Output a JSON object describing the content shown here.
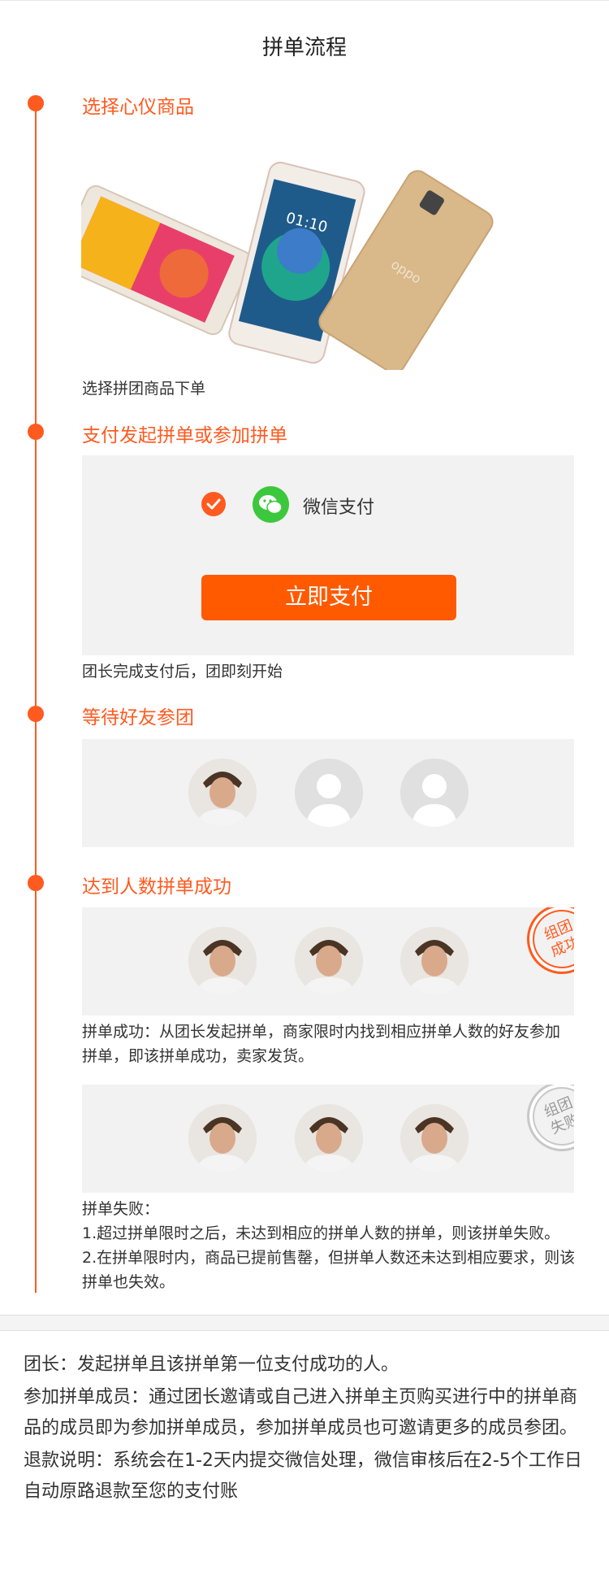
{
  "page": {
    "title": "拼单流程"
  },
  "steps": {
    "select": {
      "title": "选择心仪商品",
      "caption": "选择拼团商品下单"
    },
    "pay": {
      "title": "支付发起拼单或参加拼单",
      "method_label": "微信支付",
      "pay_button": "立即支付",
      "caption": "团长完成支付后，团即刻开始"
    },
    "wait": {
      "title": "等待好友参团"
    },
    "success": {
      "title": "达到人数拼单成功",
      "stamp_line1": "组团",
      "stamp_line2": "成功",
      "caption": "拼单成功：从团长发起拼单，商家限时内找到相应拼单人数的好友参加拼单，即该拼单成功，卖家发货。"
    },
    "fail": {
      "stamp_line1": "组团",
      "stamp_line2": "失败",
      "caption_title": "拼单失败：",
      "caption_line1": "1.超过拼单限时之后，未达到相应的拼单人数的拼单，则该拼单失败。",
      "caption_line2": "2.在拼单限时内，商品已提前售罄，但拼单人数还未达到相应要求，则该拼单也失效。"
    }
  },
  "terms": {
    "leader": "团长：发起拼单且该拼单第一位支付成功的人。",
    "member": "参加拼单成员：通过团长邀请或自己进入拼单主页购买进行中的拼单商品的成员即为参加拼单成员，参加拼单成员也可邀请更多的成员参团。",
    "refund": "退款说明：系统会在1-2天内提交微信处理，微信审核后在2-5个工作日自动原路退款至您的支付账"
  },
  "colors": {
    "accent": "#ff5a1f",
    "button": "#ff5a00",
    "wechat": "#3cc83c",
    "panel": "#f2f2f2"
  },
  "icons": [
    "check-icon",
    "wechat-icon",
    "avatar-user-icon",
    "avatar-placeholder-icon"
  ]
}
